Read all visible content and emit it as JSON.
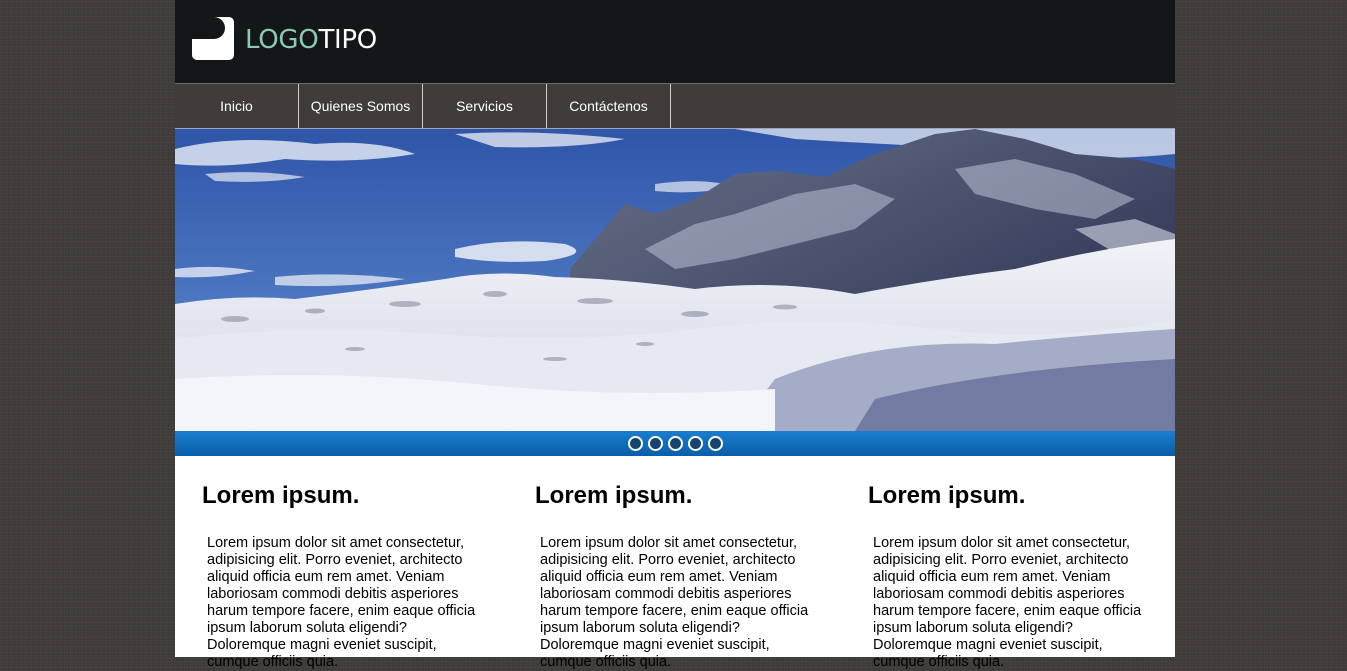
{
  "logo": {
    "text_part1": "LOGO",
    "text_part2": "TIPO"
  },
  "nav": {
    "items": [
      {
        "label": "Inicio"
      },
      {
        "label": "Quienes Somos"
      },
      {
        "label": "Servicios"
      },
      {
        "label": "Contáctenos"
      }
    ]
  },
  "slider": {
    "dot_count": 5,
    "accent_color": "#0a6cc0"
  },
  "columns": [
    {
      "title": "Lorem ipsum.",
      "body": "Lorem ipsum dolor sit amet consectetur, adipisicing elit. Porro eveniet, architecto aliquid officia eum rem amet. Veniam laboriosam commodi debitis asperiores harum tempore facere, enim eaque officia ipsum laborum soluta eligendi? Doloremque magni eveniet suscipit, cumque officiis quia."
    },
    {
      "title": "Lorem ipsum.",
      "body": "Lorem ipsum dolor sit amet consectetur, adipisicing elit. Porro eveniet, architecto aliquid officia eum rem amet. Veniam laboriosam commodi debitis asperiores harum tempore facere, enim eaque officia ipsum laborum soluta eligendi? Doloremque magni eveniet suscipit, cumque officiis quia."
    },
    {
      "title": "Lorem ipsum.",
      "body": "Lorem ipsum dolor sit amet consectetur, adipisicing elit. Porro eveniet, architecto aliquid officia eum rem amet. Veniam laboriosam commodi debitis asperiores harum tempore facere, enim eaque officia ipsum laborum soluta eligendi? Doloremque magni eveniet suscipit, cumque officiis quia."
    }
  ],
  "colors": {
    "header_bg": "#131719",
    "nav_bg": "#3f3c39",
    "logo_accent": "#8fc9b3",
    "slider_blue": "#0a6cc0"
  }
}
